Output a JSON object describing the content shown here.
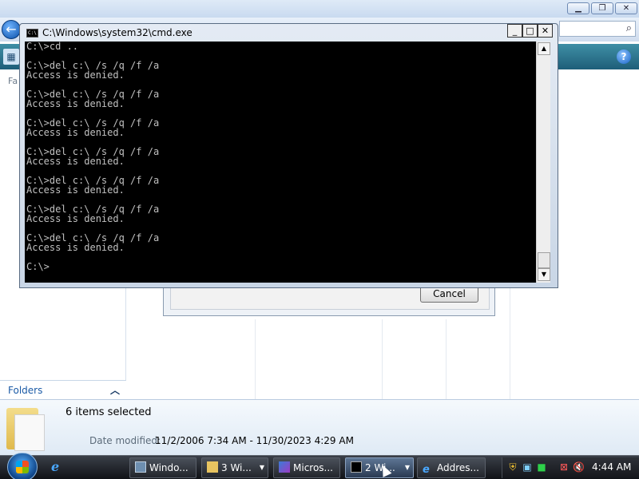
{
  "explorer": {
    "nav_favorites_fragment": "Fa",
    "folders_label": "Folders",
    "details": {
      "title": "6 items selected",
      "date_label": "Date modified:",
      "date_value": "11/2/2006 7:34 AM - 11/30/2023 4:29 AM"
    },
    "dialog_cancel_label": "Cancel"
  },
  "cmd": {
    "title": "C:\\Windows\\system32\\cmd.exe",
    "icon_text": "C:\\",
    "lines": [
      "C:\\>cd ..",
      "",
      "C:\\>del c:\\ /s /q /f /a",
      "Access is denied.",
      "",
      "C:\\>del c:\\ /s /q /f /a",
      "Access is denied.",
      "",
      "C:\\>del c:\\ /s /q /f /a",
      "Access is denied.",
      "",
      "C:\\>del c:\\ /s /q /f /a",
      "Access is denied.",
      "",
      "C:\\>del c:\\ /s /q /f /a",
      "Access is denied.",
      "",
      "C:\\>del c:\\ /s /q /f /a",
      "Access is denied.",
      "",
      "C:\\>del c:\\ /s /q /f /a",
      "Access is denied.",
      "",
      "C:\\>"
    ],
    "minimize": "_",
    "maximize": "□",
    "close": "✕"
  },
  "taskbar": {
    "tasks": [
      {
        "label": "Windo...",
        "icon": "monitor-icon"
      },
      {
        "label": "3 Wi...",
        "icon": "folder-icon"
      },
      {
        "label": "Micros...",
        "icon": "installer-icon"
      },
      {
        "label": "2 Wi...",
        "icon": "cmd-icon"
      },
      {
        "label": "Addres...",
        "icon": "ie-icon"
      }
    ],
    "clock": "4:44 AM"
  },
  "colors": {
    "console_bg": "#000000",
    "console_fg": "#c0c0c0",
    "taskbar_bg": "#1a1c20"
  }
}
